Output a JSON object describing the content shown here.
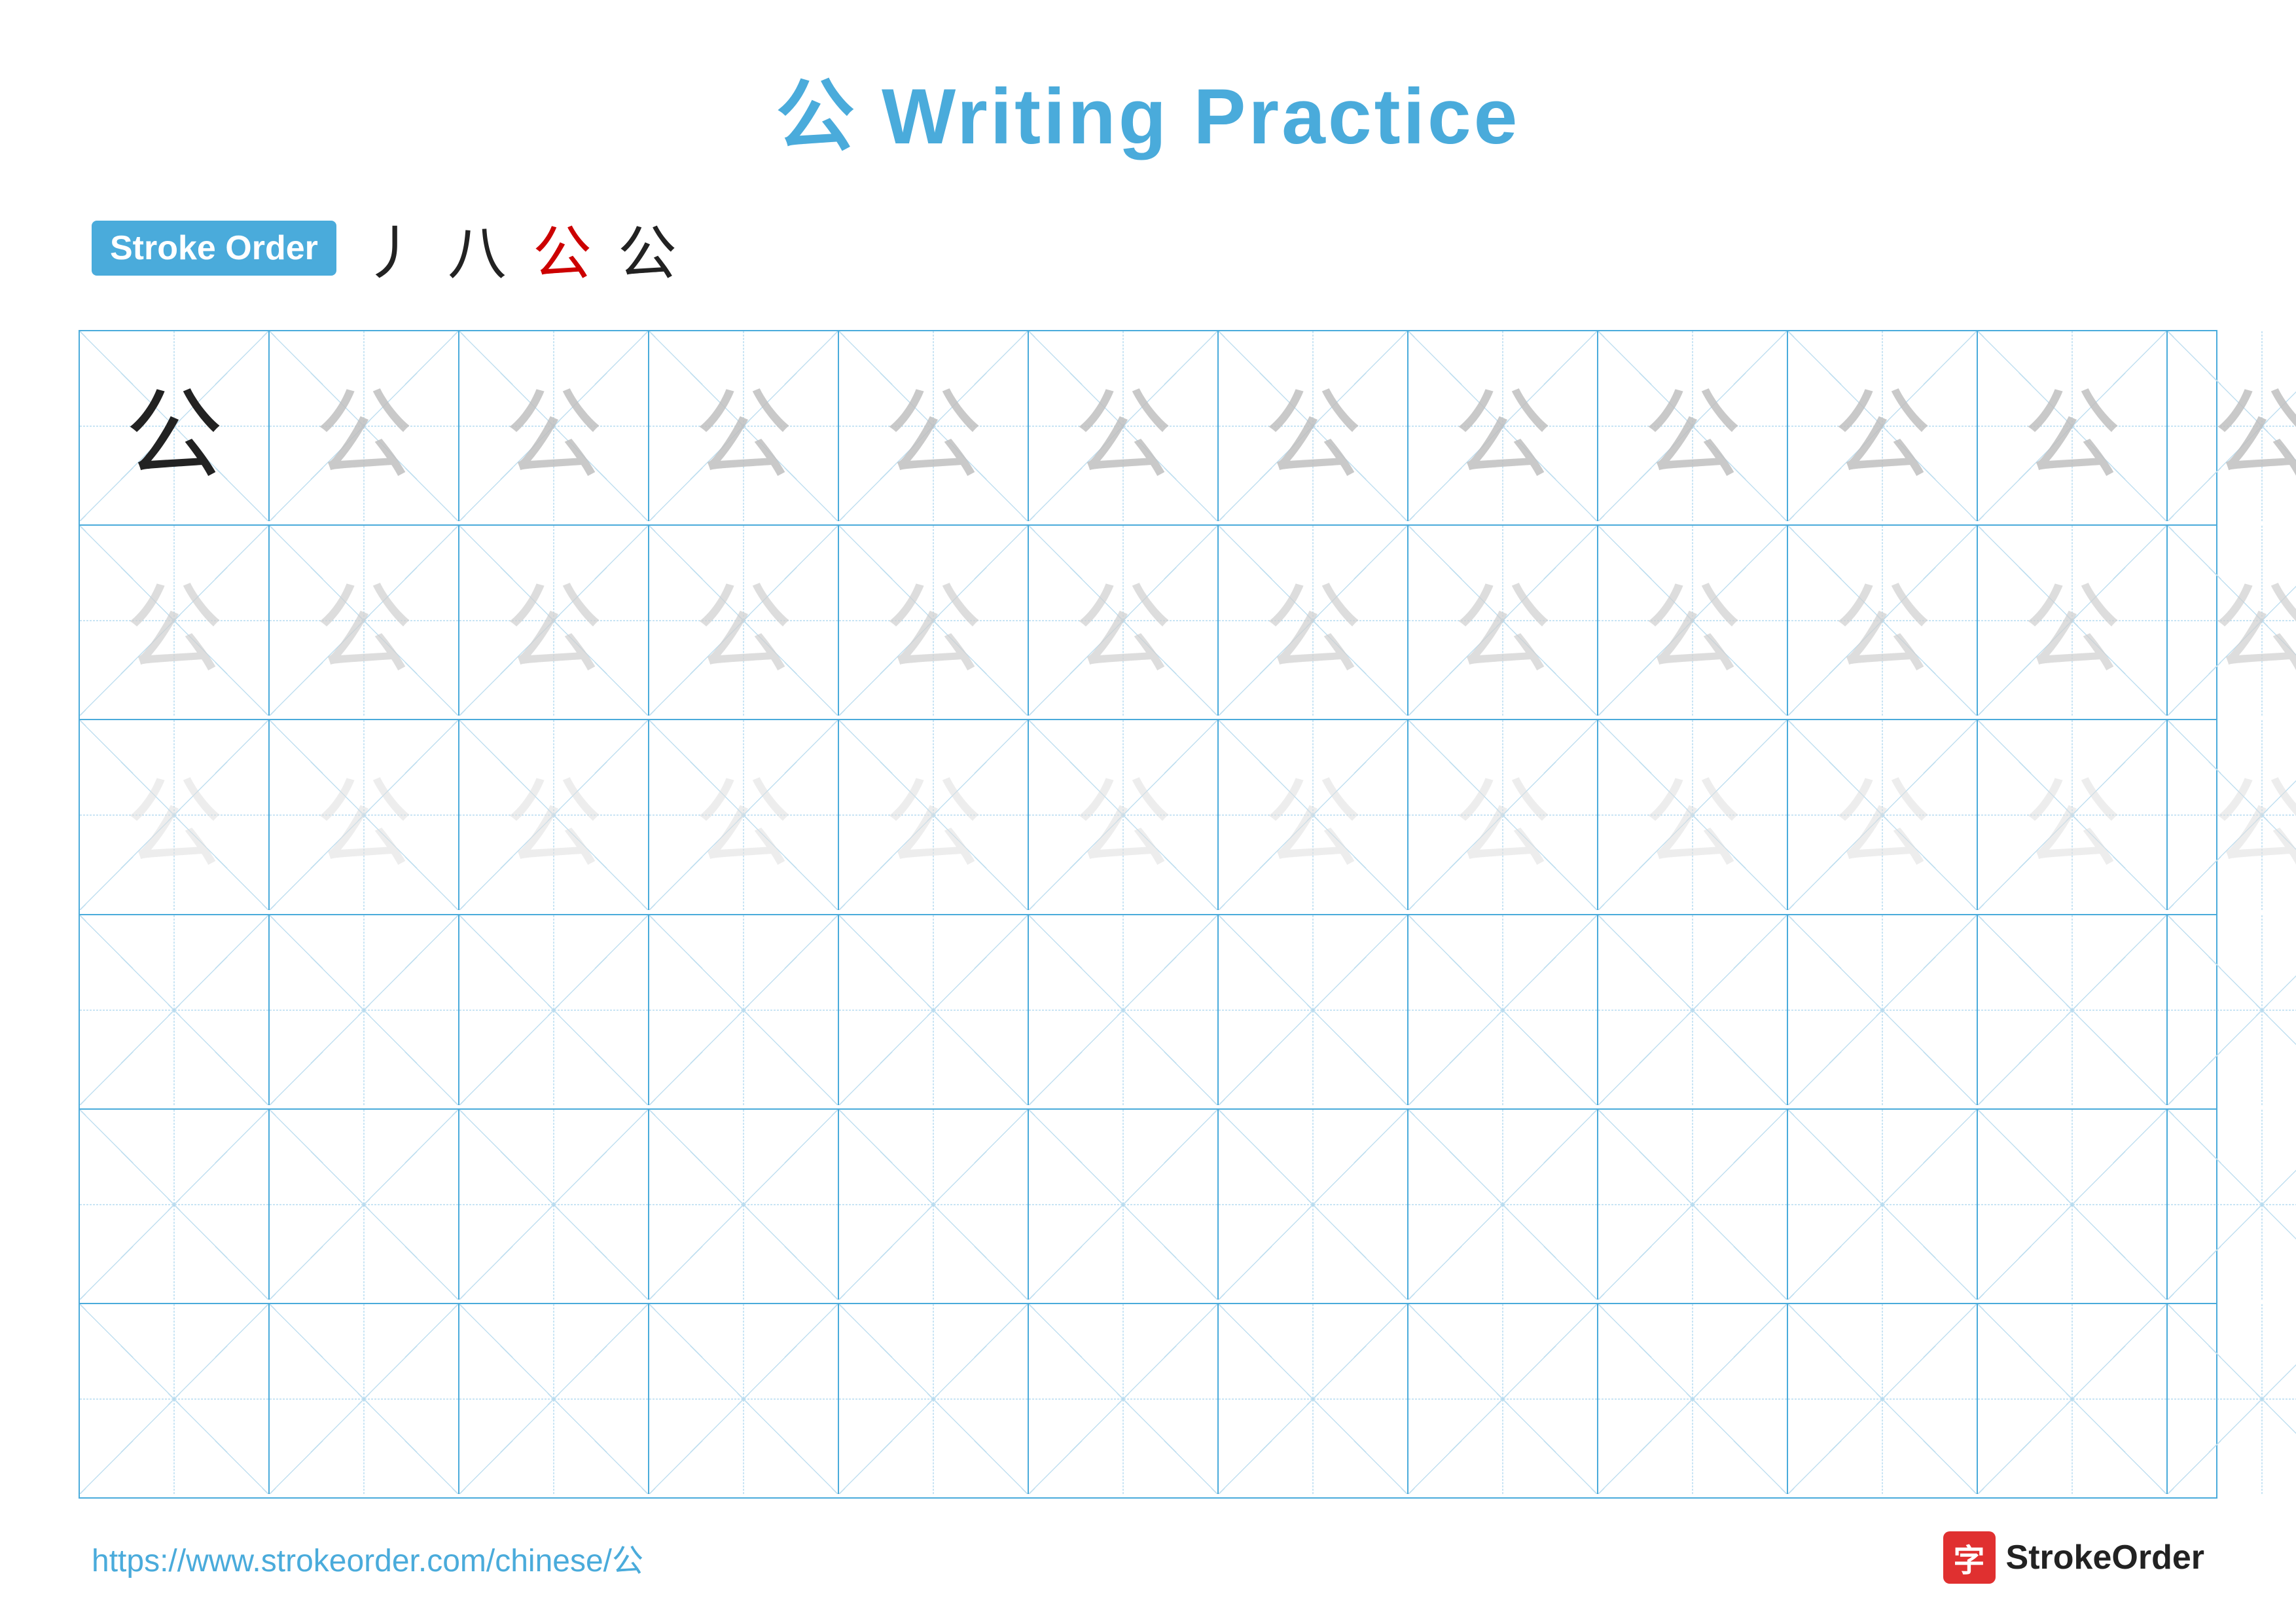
{
  "title": {
    "chinese_char": "公",
    "text": "Writing Practice"
  },
  "stroke_order": {
    "badge_label": "Stroke Order",
    "strokes": [
      "丿",
      "八",
      "公",
      "公"
    ]
  },
  "grid": {
    "rows": 6,
    "cols": 13,
    "char": "公",
    "row_types": [
      "solid_then_light1",
      "light2_row",
      "light3_row",
      "empty",
      "empty",
      "empty"
    ]
  },
  "footer": {
    "url": "https://www.strokeorder.com/chinese/公",
    "brand": "StrokeOrder",
    "logo_char": "字"
  }
}
